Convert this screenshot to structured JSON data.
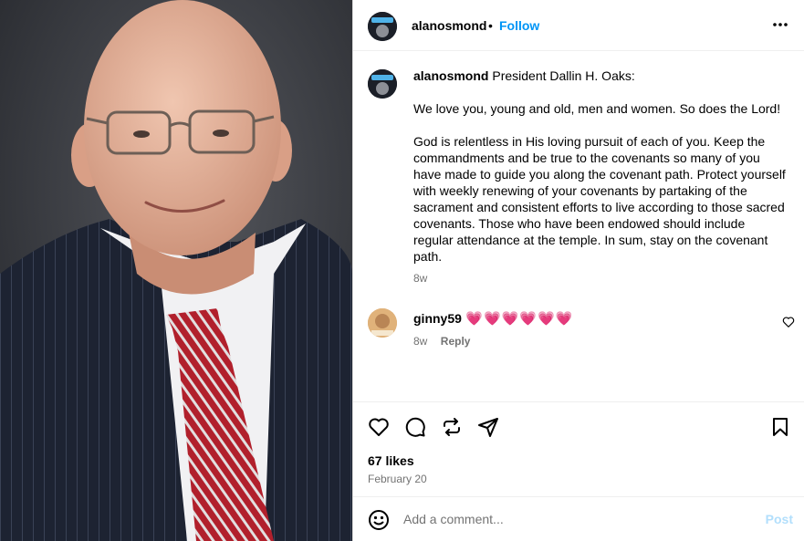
{
  "post": {
    "author": "alanosmond",
    "separator": "•",
    "follow_label": "Follow",
    "more_icon": "more-horizontal-icon",
    "photo_subject": "portrait"
  },
  "caption": {
    "author": "alanosmond",
    "lead": "President Dallin H. Oaks:",
    "paragraph1": "We love you, young and old, men and women. So does the Lord!",
    "paragraph2": "God is relentless in His loving pursuit of each of you. Keep the commandments and be true to the covenants so many of you have made to guide you along the covenant path. Protect yourself with weekly renewing of your covenants by partaking of the sacrament and consistent efforts to live according to those sacred covenants. Those who have been endowed should include regular attendance at the temple. In sum, stay on the covenant path.",
    "time": "8w"
  },
  "comments": [
    {
      "user": "ginny59",
      "text": "💗💗💗💗💗💗",
      "time": "8w",
      "reply_label": "Reply",
      "like_icon": "heart-outline-icon"
    }
  ],
  "actions": {
    "like_icon": "heart-outline-icon",
    "comment_icon": "speech-bubble-icon",
    "repost_icon": "repost-icon",
    "share_icon": "paper-plane-icon",
    "save_icon": "bookmark-icon"
  },
  "stats": {
    "likes": "67 likes",
    "date": "February 20"
  },
  "comment_box": {
    "placeholder": "Add a comment...",
    "post_label": "Post",
    "emoji_icon": "emoji-smiley-icon"
  },
  "colors": {
    "accent": "#0095f6",
    "post_disabled": "#b2dffc",
    "muted": "#737373",
    "hearts": "#ff3040",
    "photo_background": "#2f3136"
  }
}
